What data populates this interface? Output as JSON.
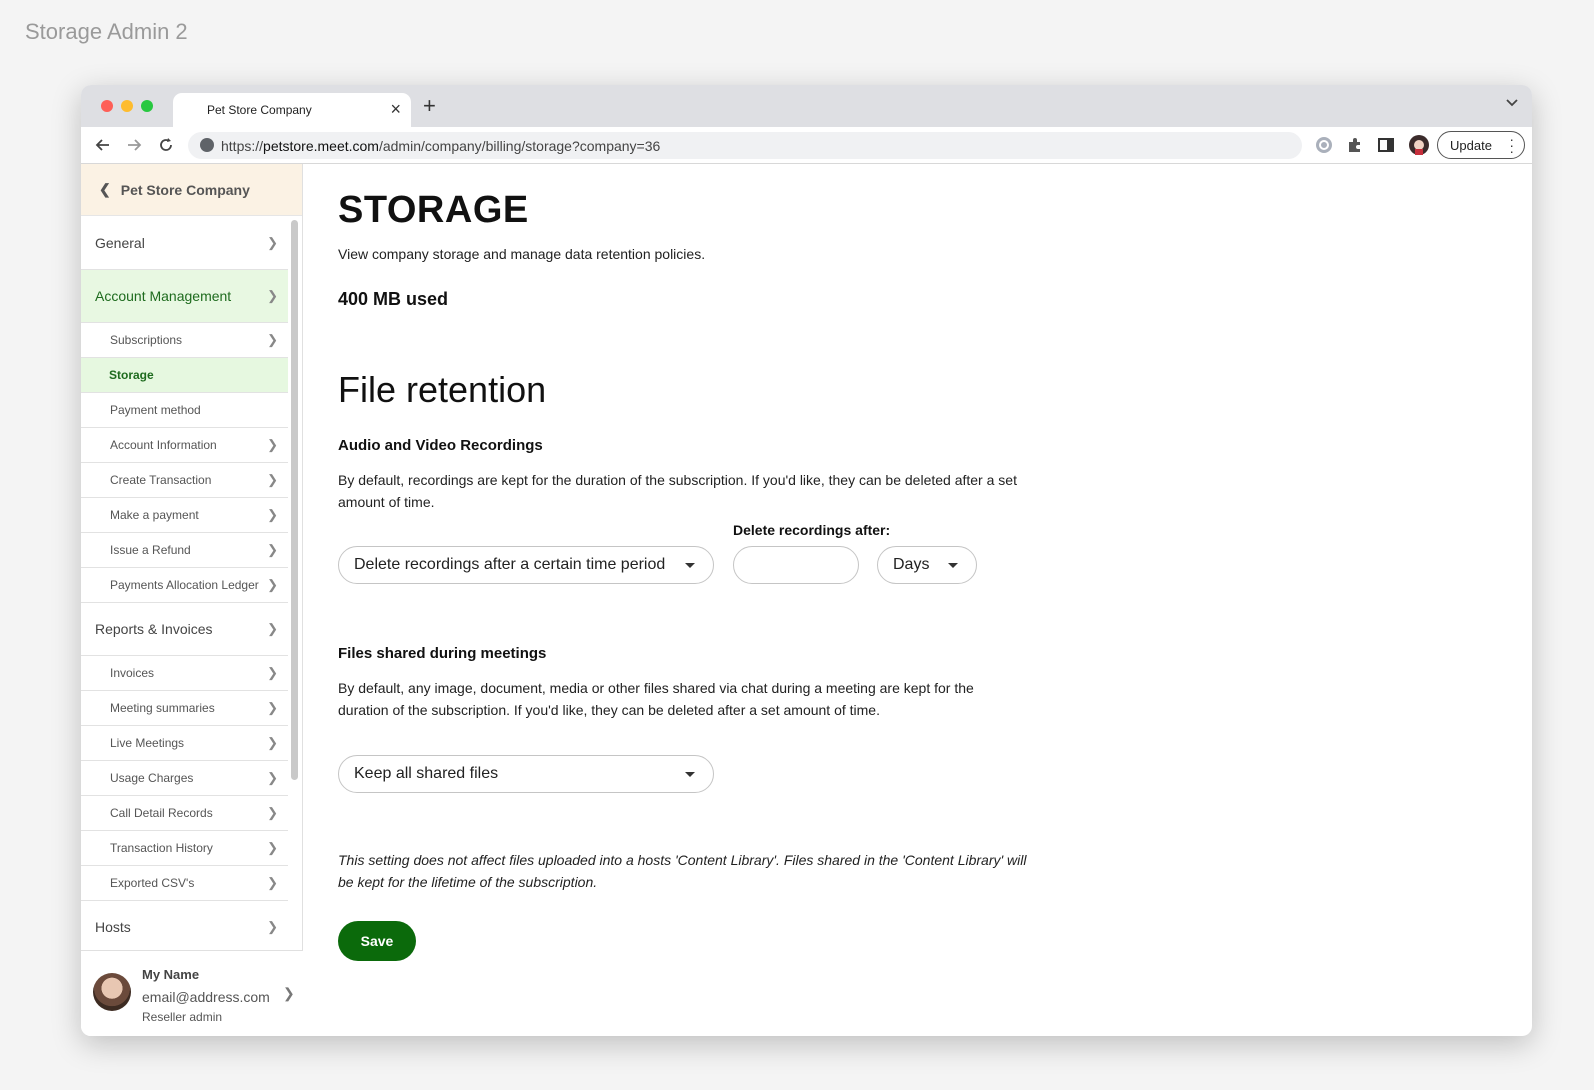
{
  "page_label": "Storage Admin 2",
  "browser": {
    "tab_title": "Pet Store Company",
    "tab_close": "×",
    "new_tab": "+",
    "url_prefix": "https://",
    "url_domain": "petstore.meet.com",
    "url_path": "/admin/company/billing/storage?company=36",
    "update_label": "Update"
  },
  "sidebar": {
    "back_label": "Pet Store Company",
    "items": [
      {
        "label": "General",
        "level": "main"
      },
      {
        "label": "Account Management",
        "level": "main",
        "active": true
      },
      {
        "label": "Subscriptions",
        "level": "sub"
      },
      {
        "label": "Storage",
        "level": "sub",
        "active": true
      },
      {
        "label": "Payment method",
        "level": "sub"
      },
      {
        "label": "Account Information",
        "level": "sub"
      },
      {
        "label": "Create Transaction",
        "level": "sub"
      },
      {
        "label": "Make a payment",
        "level": "sub"
      },
      {
        "label": "Issue a Refund",
        "level": "sub"
      },
      {
        "label": "Payments Allocation Ledger",
        "level": "sub"
      },
      {
        "label": "Reports & Invoices",
        "level": "main"
      },
      {
        "label": "Invoices",
        "level": "sub"
      },
      {
        "label": "Meeting summaries",
        "level": "sub"
      },
      {
        "label": "Live Meetings",
        "level": "sub"
      },
      {
        "label": "Usage Charges",
        "level": "sub"
      },
      {
        "label": "Call Detail Records",
        "level": "sub"
      },
      {
        "label": "Transaction History",
        "level": "sub"
      },
      {
        "label": "Exported CSV's",
        "level": "sub"
      },
      {
        "label": "Hosts",
        "level": "main"
      }
    ],
    "user": {
      "name": "My Name",
      "email": "email@address.com",
      "role": "Reseller admin"
    }
  },
  "main": {
    "title": "STORAGE",
    "description": "View company storage and manage data retention policies.",
    "used": "400 MB used",
    "retention_title": "File retention",
    "recordings": {
      "heading": "Audio and  Video Recordings",
      "text": "By default, recordings are kept for the duration of the subscription. If you'd like, they can be deleted after a set amount of time.",
      "policy_selected": "Delete recordings after a certain time period",
      "delete_after_label": "Delete recordings after:",
      "delete_after_value": "",
      "unit_selected": "Days"
    },
    "files": {
      "heading": "Files shared during meetings",
      "text": "By default, any image, document, media or other files shared via chat during a meeting are kept for the duration of the subscription. If you'd like, they can be deleted after a set amount of time.",
      "policy_selected": "Keep all shared files"
    },
    "note": "This setting does not affect files uploaded into a hosts 'Content Library'. Files shared in the 'Content Library' will be kept for the lifetime of the subscription.",
    "save_label": "Save"
  },
  "colors": {
    "accent": "#0b6a0b",
    "active_bg": "#e6f8e0",
    "back_bg": "#fbf2e4",
    "chat": "#c79a6a"
  }
}
